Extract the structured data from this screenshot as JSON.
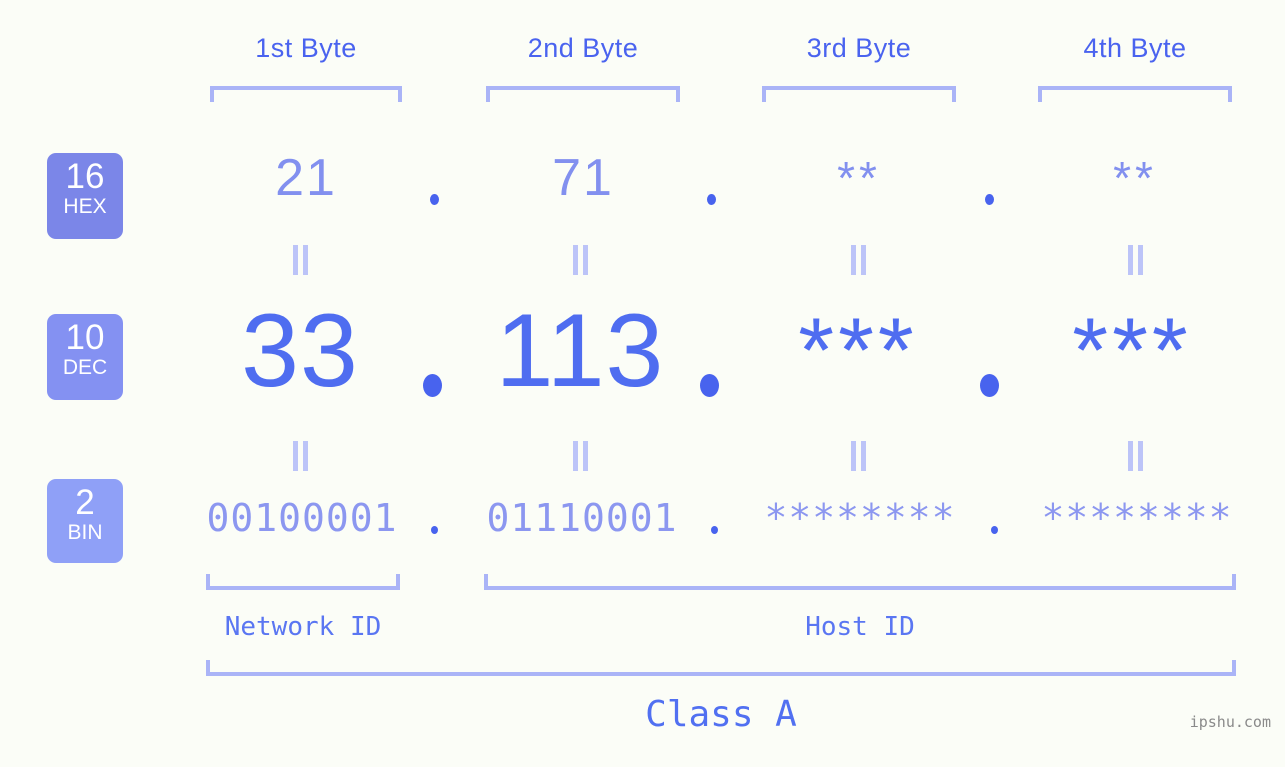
{
  "background_color": "#fbfdf7",
  "accent_colors": {
    "bracket": "#aab4f7",
    "byte_label": "#4a63ef",
    "hex_value": "#8290ef",
    "dec_value": "#4f6df0",
    "bin_value": "#8c97f0",
    "dot": "#4863ee",
    "equals": "#bcc4f8",
    "badge_hex": "#7b86e8",
    "badge_dec": "#8491f2",
    "badge_bin": "#8fa0f7",
    "id_label": "#5a76f2",
    "class_label": "#5170f1",
    "watermark": "#8a8a8a"
  },
  "byte_headers": [
    {
      "label": "1st Byte"
    },
    {
      "label": "2nd Byte"
    },
    {
      "label": "3rd Byte"
    },
    {
      "label": "4th Byte"
    }
  ],
  "base_badges": [
    {
      "number": "16",
      "name": "HEX"
    },
    {
      "number": "10",
      "name": "DEC"
    },
    {
      "number": "2",
      "name": "BIN"
    }
  ],
  "rows": {
    "hex": {
      "base": "16",
      "base_name": "HEX",
      "values": [
        "21",
        "71",
        "**",
        "**"
      ],
      "separators": [
        ".",
        ".",
        "."
      ]
    },
    "dec": {
      "base": "10",
      "base_name": "DEC",
      "values": [
        "33",
        "113",
        "***",
        "***"
      ],
      "separators": [
        ".",
        ".",
        "."
      ]
    },
    "bin": {
      "base": "2",
      "base_name": "BIN",
      "values": [
        "00100001",
        "01110001",
        "********",
        "********"
      ],
      "separators": [
        ".",
        ".",
        "."
      ]
    }
  },
  "equals_symbol": "=",
  "id_sections": [
    {
      "label": "Network ID"
    },
    {
      "label": "Host ID"
    }
  ],
  "class_label": "Class A",
  "watermark": "ipshu.com"
}
